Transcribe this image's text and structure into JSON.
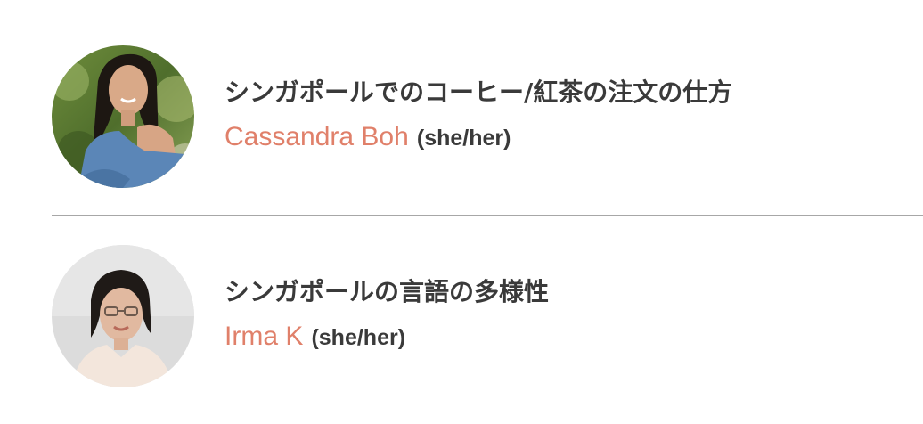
{
  "articles": [
    {
      "title": "シンガポールでのコーヒー/紅茶の注文の仕方",
      "author": "Cassandra Boh",
      "pronouns": "(she/her)"
    },
    {
      "title": "シンガポールの言語の多様性",
      "author": "Irma K",
      "pronouns": "(she/her)"
    }
  ],
  "colors": {
    "author_accent": "#e0806a",
    "title_text": "#3a3a3a",
    "divider": "#a7a7a7"
  }
}
